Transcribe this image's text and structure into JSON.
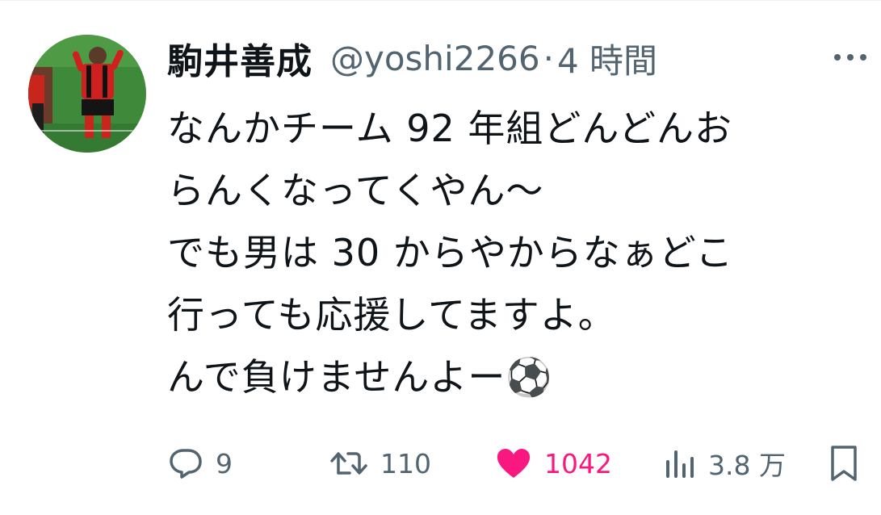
{
  "author": {
    "display_name": "駒井善成",
    "handle": "@yoshi2266",
    "separator": "·",
    "time": "4 時間"
  },
  "tweet": {
    "lines": [
      "なんかチーム 92 年組どんどんお",
      "らんくなってくやん〜",
      "でも男は 30 からやからなぁどこ",
      "行っても応援してますよ。",
      "んで負けませんよー⚽️"
    ]
  },
  "actions": {
    "reply_count": "9",
    "retweet_count": "110",
    "like_count": "1042",
    "views_count": "3.8 万"
  },
  "icons": {
    "more": "more-dots-icon",
    "reply": "reply-bubble-icon",
    "retweet": "retweet-icon",
    "like": "heart-icon",
    "views": "views-bar-chart-icon",
    "bookmark": "bookmark-icon"
  },
  "colors": {
    "primary_text": "#0f1419",
    "secondary_text": "#536471",
    "like_pink": "#f91880"
  }
}
